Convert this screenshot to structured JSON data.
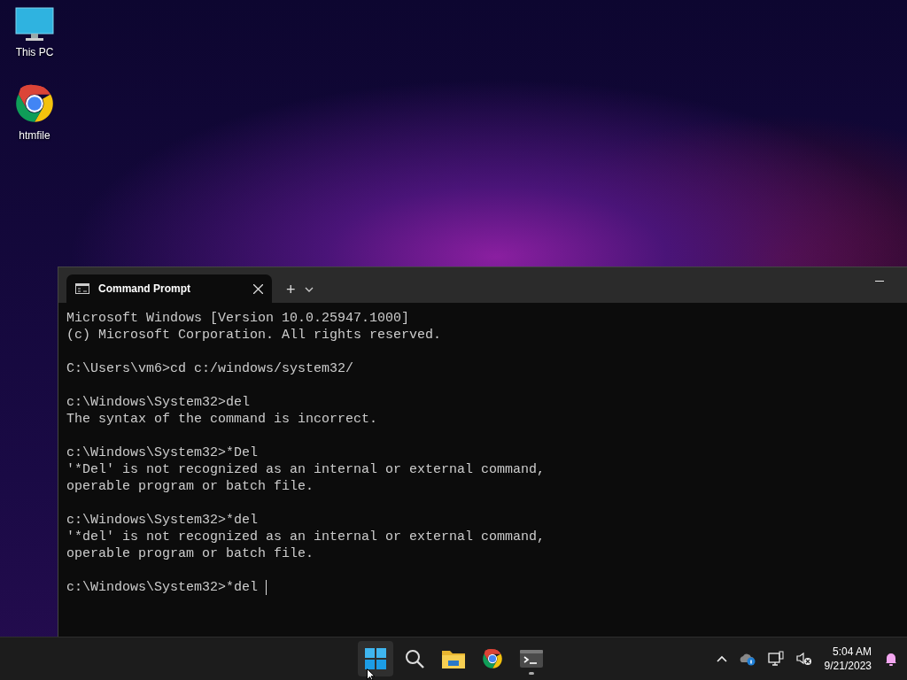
{
  "desktop_icons": [
    {
      "kind": "computer",
      "label": "This PC"
    },
    {
      "kind": "browser",
      "label": "htmfile"
    }
  ],
  "terminal": {
    "tabs": [
      {
        "title": "Command Prompt",
        "selected": true
      }
    ],
    "new_tab": "+",
    "blocks": [
      [
        "Microsoft Windows [Version 10.0.25947.1000]",
        "(c) Microsoft Corporation. All rights reserved."
      ],
      [
        "C:\\Users\\vm6>cd c:/windows/system32/"
      ],
      [
        "c:\\Windows\\System32>del",
        "The syntax of the command is incorrect."
      ],
      [
        "c:\\Windows\\System32>*Del",
        "'*Del' is not recognized as an internal or external command,",
        "operable program or batch file."
      ],
      [
        "c:\\Windows\\System32>*del",
        "'*del' is not recognized as an internal or external command,",
        "operable program or batch file."
      ],
      [
        "c:\\Windows\\System32>*del "
      ]
    ]
  },
  "taskbar": {
    "apps": [
      {
        "kind": "start",
        "hovered": true,
        "running": false
      },
      {
        "kind": "search",
        "hovered": false,
        "running": false
      },
      {
        "kind": "files",
        "hovered": false,
        "running": false
      },
      {
        "kind": "browser",
        "hovered": false,
        "running": false
      },
      {
        "kind": "terminal",
        "hovered": false,
        "running": true
      }
    ],
    "time": "5:04 AM",
    "date": "9/21/2023"
  }
}
